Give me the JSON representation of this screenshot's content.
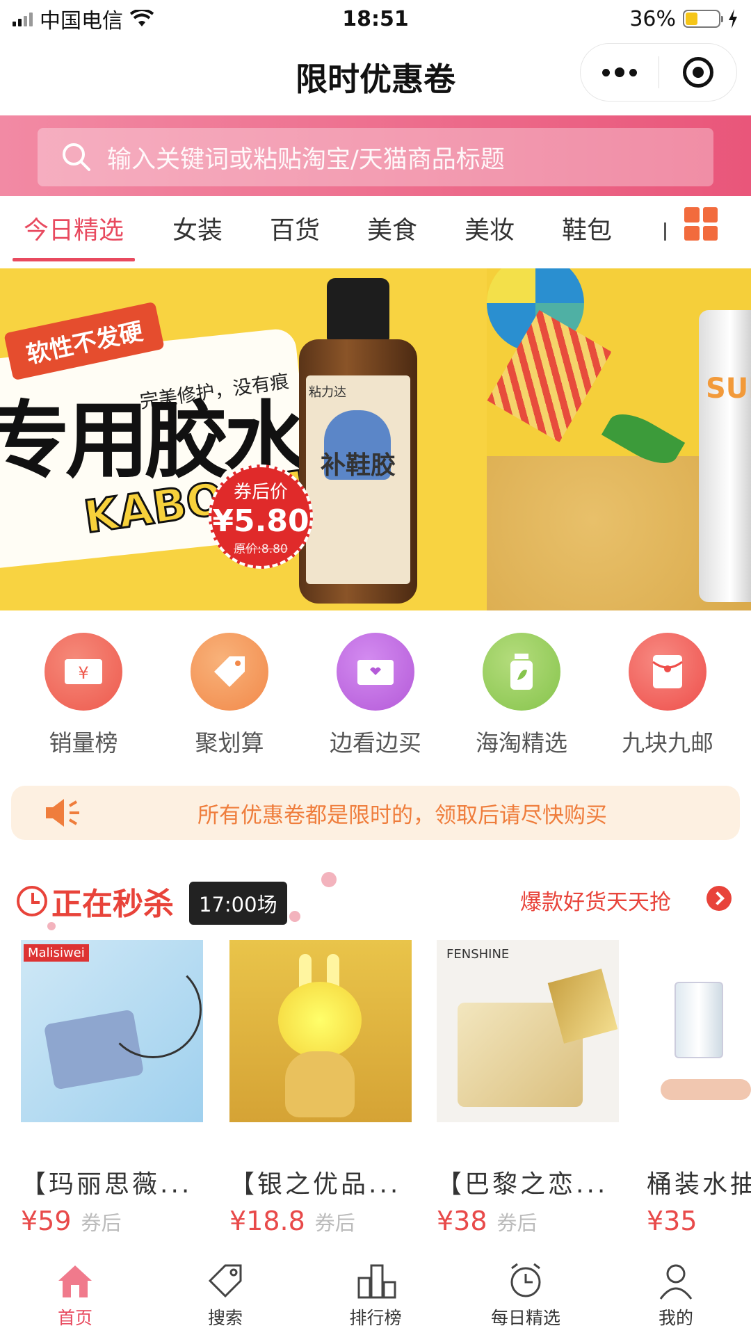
{
  "status_bar": {
    "carrier": "中国电信",
    "time": "18:51",
    "battery_percent": "36%",
    "battery_level": 0.36
  },
  "header": {
    "title": "限时优惠卷"
  },
  "search": {
    "placeholder": "输入关键词或粘贴淘宝/天猫商品标题"
  },
  "tabs": [
    {
      "label": "今日精选",
      "active": true
    },
    {
      "label": "女装",
      "active": false
    },
    {
      "label": "百货",
      "active": false
    },
    {
      "label": "美食",
      "active": false
    },
    {
      "label": "美妆",
      "active": false
    },
    {
      "label": "鞋包",
      "active": false
    }
  ],
  "banner": {
    "tag": "软性不发硬",
    "subtitle": "完美修护，没有痕",
    "headline": "专用胶水",
    "kaboom": "KABOOM",
    "price_label": "券后价",
    "price": "¥5.80",
    "original_price": "原价:8.80",
    "bottle_brand": "粘力达",
    "bottle_name": "补鞋胶",
    "side_text": "SUN"
  },
  "quick_links": [
    {
      "label": "销量榜",
      "icon": "ticket-icon",
      "color": "#ee5a4e"
    },
    {
      "label": "聚划算",
      "icon": "price-tag-icon",
      "color": "#f2894a"
    },
    {
      "label": "边看边买",
      "icon": "envelope-heart-icon",
      "color": "#b45ad8"
    },
    {
      "label": "海淘精选",
      "icon": "bottle-leaf-icon",
      "color": "#86c44c"
    },
    {
      "label": "九块九邮",
      "icon": "red-envelope-icon",
      "color": "#ee4e4a"
    }
  ],
  "notice": {
    "text": "所有优惠卷都是限时的，领取后请尽快购买"
  },
  "flash_sale": {
    "title": "正在秒杀",
    "session": "17:00场",
    "more": "爆款好货天天抢"
  },
  "products": [
    {
      "name": "【玛丽思薇...",
      "price": "¥59",
      "tag": "券后",
      "brand_mark": "Malisiwei"
    },
    {
      "name": "【银之优品...",
      "price": "¥18.8",
      "tag": "券后"
    },
    {
      "name": "【巴黎之恋...",
      "price": "¥38",
      "tag": "券后",
      "brand_mark": "FENSHINE"
    },
    {
      "name": "桶装水抽",
      "price": "¥35",
      "tag": ""
    }
  ],
  "tabbar": [
    {
      "label": "首页",
      "icon": "home-icon",
      "active": true
    },
    {
      "label": "搜索",
      "icon": "tag-search-icon",
      "active": false
    },
    {
      "label": "排行榜",
      "icon": "podium-icon",
      "active": false
    },
    {
      "label": "每日精选",
      "icon": "alarm-clock-icon",
      "active": false
    },
    {
      "label": "我的",
      "icon": "user-icon",
      "active": false
    }
  ],
  "colors": {
    "accent": "#e84a5f",
    "search_gradient_start": "#f28aa4",
    "search_gradient_end": "#e9567a",
    "notice": "#ef7d3c",
    "flash": "#e8433a"
  }
}
